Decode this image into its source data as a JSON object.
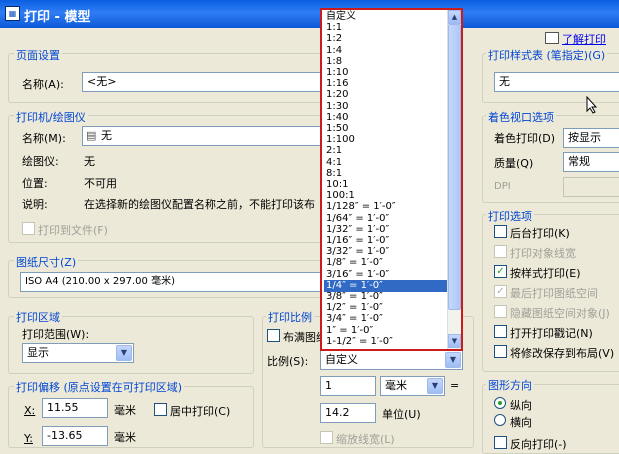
{
  "title": "打印 - 模型",
  "help_link": "了解打印",
  "page_setup": {
    "group": "页面设置",
    "name_label": "名称(A):",
    "name_value": "<无>"
  },
  "printer": {
    "group": "打印机/绘图仪",
    "name_label": "名称(M):",
    "name_value": "无",
    "plotter_label": "绘图仪:",
    "plotter_value": "无",
    "location_label": "位置:",
    "location_value": "不可用",
    "desc_label": "说明:",
    "desc_value": "在选择新的绘图仪配置名称之前，不能打印该布",
    "print_to_file": "打印到文件(F)"
  },
  "paper_size": {
    "group": "图纸尺寸(Z)",
    "value": "ISO A4 (210.00 x 297.00 毫米)"
  },
  "plot_area": {
    "group": "打印区域",
    "range_label": "打印范围(W):",
    "range_value": "显示"
  },
  "plot_offset": {
    "group": "打印偏移 (原点设置在可打印区域)",
    "x_label": "X:",
    "x_value": "11.55",
    "x_unit": "毫米",
    "center": "居中打印(C)",
    "y_label": "Y:",
    "y_value": "-13.65",
    "y_unit": "毫米"
  },
  "plot_scale": {
    "group": "打印比例",
    "fit": "布满图纸",
    "scale_label": "比例(S):",
    "scale_value": "自定义",
    "num_value": "1",
    "unit_value": "毫米",
    "eq": "=",
    "units_value": "14.2",
    "units_label": "单位(U)",
    "lineweight": "缩放线宽(L)"
  },
  "scale_list": [
    "自定义",
    "1:1",
    "1:2",
    "1:4",
    "1:8",
    "1:10",
    "1:16",
    "1:20",
    "1:30",
    "1:40",
    "1:50",
    "1:100",
    "2:1",
    "4:1",
    "8:1",
    "10:1",
    "100:1",
    "1/128″ = 1′-0″",
    "1/64″ = 1′-0″",
    "1/32″ = 1′-0″",
    "1/16″ = 1′-0″",
    "3/32″ = 1′-0″",
    "1/8″ = 1′-0″",
    "3/16″ = 1′-0″",
    "1/4″ = 1′-0″",
    "3/8″ = 1′-0″",
    "1/2″ = 1′-0″",
    "3/4″ = 1′-0″",
    "1″ = 1′-0″",
    "1-1/2″ = 1′-0″"
  ],
  "scale_selected_index": 24,
  "plot_style": {
    "group": "打印样式表 (笔指定)(G)",
    "value": "无"
  },
  "shaded": {
    "group": "着色视口选项",
    "shade_label": "着色打印(D)",
    "shade_value": "按显示",
    "quality_label": "质量(Q)",
    "quality_value": "常规",
    "dpi_label": "DPI"
  },
  "options": {
    "group": "打印选项",
    "items": [
      "后台打印(K)",
      "打印对象线宽",
      "按样式打印(E)",
      "最后打印图纸空间",
      "隐藏图纸空间对象(J)",
      "打开打印戳记(N)",
      "将修改保存到布局(V)"
    ],
    "checked": [
      false,
      false,
      true,
      true,
      false,
      false,
      false
    ],
    "disabled": [
      false,
      true,
      false,
      true,
      true,
      false,
      false
    ]
  },
  "orientation": {
    "group": "图形方向",
    "portrait": "纵向",
    "landscape": "横向",
    "reverse": "反向打印(-)"
  }
}
